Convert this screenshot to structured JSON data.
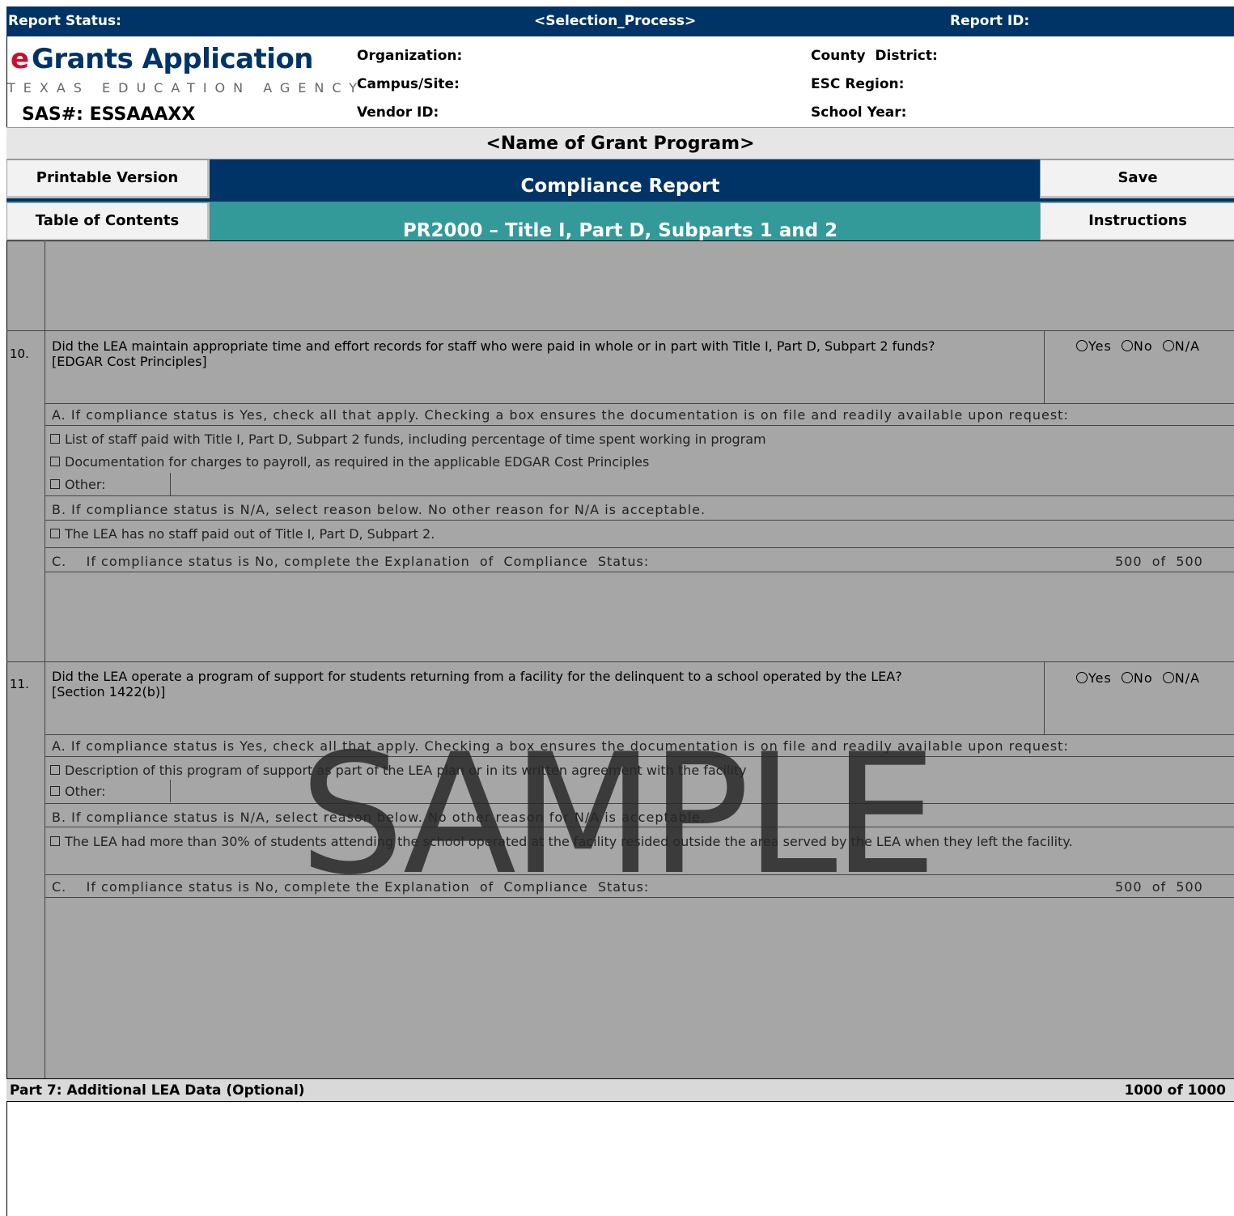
{
  "status_bar": {
    "report_status_label": "Report Status:",
    "selection_process": "<Selection_Process>",
    "report_id_label": "Report ID:"
  },
  "header": {
    "logo_e": "e",
    "logo_main": "Grants Application",
    "logo_sub": "TEXAS EDUCATION AGENCY",
    "sas": "SAS#: ESSAAAXX",
    "organization_label": "Organization:",
    "campus_label": "Campus/Site:",
    "vendor_label": "Vendor ID:",
    "county_label": "County  District:",
    "esc_label": "ESC Region:",
    "school_year_label": "School Year:"
  },
  "grant_program": "<Name of Grant Program>",
  "title": "Compliance Report",
  "subtitle": "PR2000 – Title I, Part D, Subparts 1 and 2",
  "nav": {
    "printable": "Printable Version",
    "toc": "Table of Contents",
    "save": "Save",
    "instructions": "Instructions"
  },
  "questions": [
    {
      "number": "10.",
      "text": "Did the LEA maintain appropriate time and effort records for staff who were paid in whole or in part with Title I, Part D, Subpart 2 funds?",
      "citation": "[EDGAR Cost Principles]",
      "options": [
        "Yes",
        "No",
        "N/A"
      ],
      "section_a": "A.    If compliance status is Yes, check all that apply. Checking a box ensures the documentation is on file and readily available upon request:",
      "a_items": [
        "List of staff paid with Title I, Part D, Subpart 2 funds, including percentage of time spent working in program",
        "Documentation for charges to payroll, as required in the applicable EDGAR Cost Principles"
      ],
      "other_label": "Other:",
      "section_b": "B.    If compliance status is N/A, select reason below. No other reason for N/A is acceptable.",
      "b_items": [
        "The LEA has no staff paid out of Title I, Part D, Subpart 2."
      ],
      "section_c": "C.    If compliance status is No, complete the Explanation  of  Compliance  Status:",
      "counter": "500  of  500"
    },
    {
      "number": "11.",
      "text": "Did the LEA operate a program of support for students returning from a facility for the delinquent to a school operated by the LEA?",
      "citation": "[Section 1422(b)]",
      "options": [
        "Yes",
        "No",
        "N/A"
      ],
      "section_a": "A.    If compliance status is Yes, check all that apply. Checking a box ensures the documentation is on file and readily available upon request:",
      "a_items": [
        "Description of this program of support as part of the LEA plan or in its written agreement with the facility"
      ],
      "other_label": "Other:",
      "section_b": "B.    If compliance status is N/A, select reason below. No other reason for N/A is acceptable.",
      "b_items": [
        "The LEA had more than 30% of students attending the school operated at the facility resided outside the area served by the LEA when they left the facility."
      ],
      "section_c": "C.    If compliance status is No, complete the Explanation  of  Compliance  Status:",
      "counter": "500  of  500"
    }
  ],
  "part7": {
    "label": "Part 7: Additional LEA Data (Optional)",
    "counter": "1000 of 1000"
  },
  "watermark": "SAMPLE",
  "colors": {
    "navy": "#003366",
    "teal": "#339999",
    "form_grey": "#a6a6a6",
    "logo_red": "#c8102e"
  }
}
